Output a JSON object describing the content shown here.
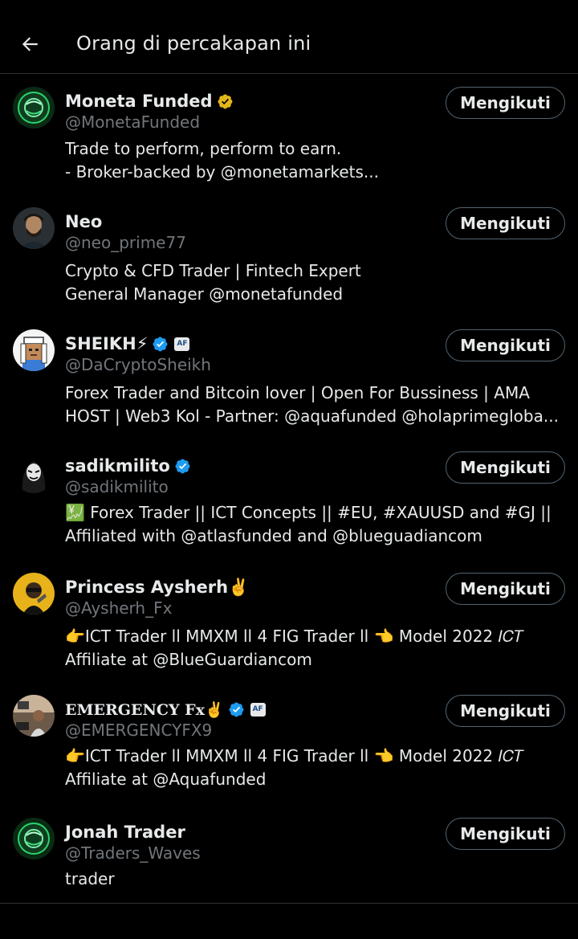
{
  "header": {
    "back_icon": "arrow-left-icon",
    "title": "Orang di percakapan ini"
  },
  "colors": {
    "verified_blue": "#1d9bf0",
    "verified_gold": "#e2b719",
    "handle_gray": "#71767b",
    "divider": "#2f3336"
  },
  "users": [
    {
      "name": "Moneta Funded",
      "verified": "gold",
      "handle": "@MonetaFunded",
      "bio": [
        "Trade to perform, perform to earn.",
        "- Broker-backed by @monetamarkets..."
      ],
      "button": "Mengikuti"
    },
    {
      "name": "Neo",
      "handle": "@neo_prime77",
      "bio": [
        "Crypto & CFD Trader | Fintech Expert",
        "General Manager @monetafunded"
      ],
      "button": "Mengikuti"
    },
    {
      "name": "SHEIKH⚡",
      "verified": "blue",
      "affiliate": "AF",
      "handle": "@DaCryptoSheikh",
      "bio": [
        "Forex Trader and Bitcoin lover | Open For Bussiness | AMA",
        "HOST | Web3 Kol - Partner: @aquafunded @holaprimegloba..."
      ],
      "button": "Mengikuti"
    },
    {
      "name": "sadikmilito",
      "verified": "blue",
      "handle": "@sadikmilito",
      "bio": [
        "💹 Forex Trader || ICT Concepts || #EU, #XAUUSD and #GJ ||",
        "Affiliated with @atlasfunded and @blueguadiancom"
      ],
      "button": "Mengikuti"
    },
    {
      "name": "Princess Aysherh✌️",
      "handle": "@Aysherh_Fx",
      "bio": [
        "👉ICT Trader ll MMXM ll 4 FIG Trader ll 👈 Model 2022 𝐼𝐶𝑇",
        "Affiliate at @BlueGuardiancom"
      ],
      "button": "Mengikuti"
    },
    {
      "name": "𝐄𝐌𝐄𝐑𝐆𝐄𝐍𝐂𝐘 𝐅𝐱✌️",
      "verified": "blue",
      "affiliate": "AF",
      "handle": "@EMERGENCYFX9",
      "bio": [
        "👉ICT Trader ll MMXM ll 4 FIG Trader ll 👈 Model 2022 𝐼𝐶𝑇",
        "Affiliate at @Aquafunded"
      ],
      "button": "Mengikuti"
    },
    {
      "name": "Jonah Trader",
      "handle": "@Traders_Waves",
      "bio": [
        "trader"
      ],
      "button": "Mengikuti"
    }
  ]
}
